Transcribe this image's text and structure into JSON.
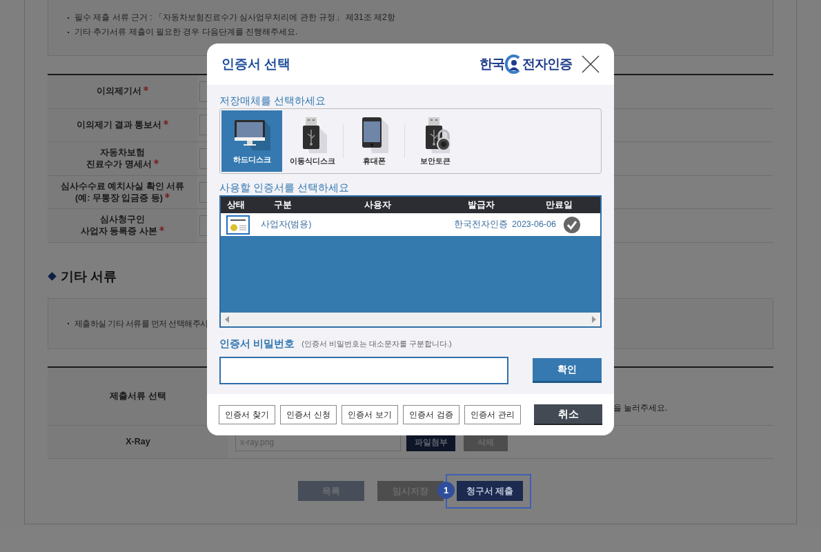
{
  "page": {
    "notes": [
      "필수 제출 서류 근거 : 「자동차보험진료수가 심사업무처리에 관한 규정」 제31조 제2항",
      "기타 추가서류 제출이 필요한 경우 다음단계를 진행해주세요."
    ],
    "required_documents": [
      {
        "label": "이의제기서",
        "required": true
      },
      {
        "label": "이의제기 결과 통보서",
        "required": true
      },
      {
        "label": "자동차보험\n진료수가 명세서",
        "required": true
      },
      {
        "label": "심사수수료 예치사실 확인 서류\n(예: 무통장 입금증 등)",
        "required": true
      },
      {
        "label": "심사청구인\n사업자 등록증 사본",
        "required": true
      }
    ],
    "section_title": "기타 서류",
    "other_notes": [
      "제출하실 기타 서류를 먼저 선택해주시"
    ],
    "submission_rows": [
      {
        "kind": "select",
        "label": "제출서류 선택",
        "text": "을 눌러주세요."
      },
      {
        "kind": "file",
        "label": "X-Ray",
        "file": "x-ray.png",
        "buttons": [
          "파일첨부",
          "삭제"
        ]
      }
    ],
    "actions": [
      {
        "kind": "list",
        "label": "목록",
        "highlighted": false
      },
      {
        "kind": "draft",
        "label": "임시저장",
        "highlighted": false
      },
      {
        "kind": "submit",
        "label": "청구서 제출",
        "highlighted": true,
        "step": "1"
      }
    ]
  },
  "dialog": {
    "title": "인증서 선택",
    "logo": {
      "left": "한국",
      "right": "전자인증"
    },
    "media_heading": "저장매체를 선택하세요",
    "media": [
      {
        "kind": "harddisk",
        "label": "하드디스크",
        "selected": true
      },
      {
        "kind": "usb",
        "label": "이동식디스크",
        "selected": false
      },
      {
        "kind": "phone",
        "label": "휴대폰",
        "selected": false
      },
      {
        "kind": "token",
        "label": "보안토큰",
        "selected": false
      }
    ],
    "cert_heading": "사용할 인증서를 선택하세요",
    "cert_table": {
      "columns": [
        "상태",
        "구분",
        "사용자",
        "발급자",
        "만료일"
      ],
      "rows": [
        {
          "type": "사업자(범용)",
          "issuer": "한국전자인증",
          "expiry": "2023-06-06",
          "valid": true
        }
      ]
    },
    "password": {
      "label": "인증서 비밀번호",
      "hint": "(인증서 비밀번호는 대소문자를 구분합니다.)"
    },
    "confirm": "확인",
    "footer_buttons": [
      "인증서 찾기",
      "인증서 신청",
      "인증서 보기",
      "인증서 검증",
      "인증서 관리"
    ],
    "cancel": "취소"
  }
}
